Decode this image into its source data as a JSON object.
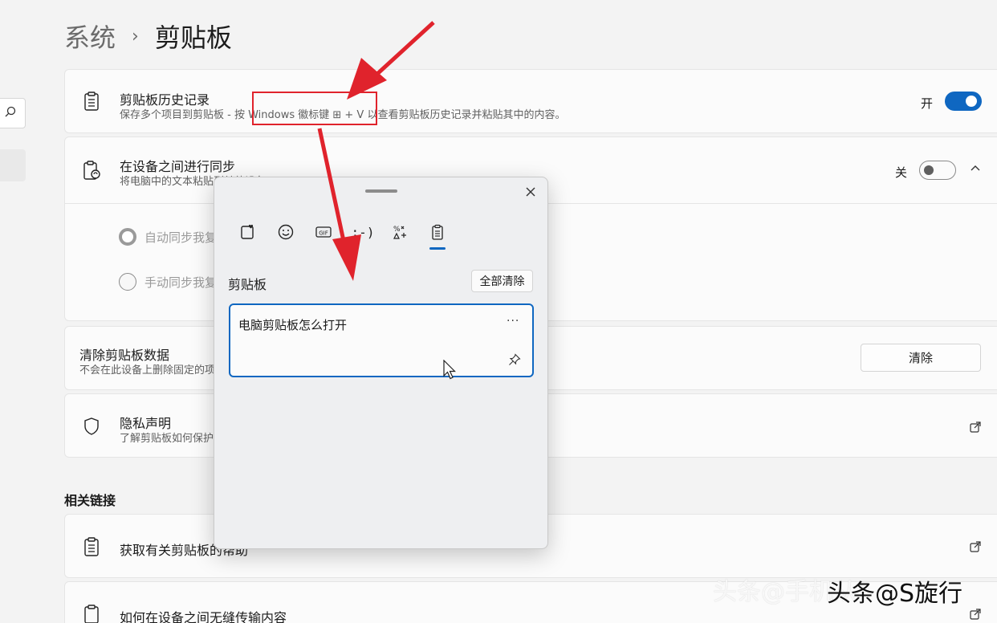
{
  "breadcrumb": {
    "parent": "系统",
    "separator": "›",
    "current": "剪贴板"
  },
  "history": {
    "title": "剪贴板历史记录",
    "desc": "保存多个项目到剪贴板 - 按 Windows 徽标键 ⊞ + V 以查看剪贴板历史记录并粘贴其中的内容。",
    "toggle_label": "开",
    "toggle_on": true
  },
  "sync": {
    "title": "在设备之间进行同步",
    "desc": "将电脑中的文本粘贴到其他设备",
    "toggle_label": "关",
    "toggle_on": false,
    "options": [
      "自动同步我复制的文本",
      "手动同步我复制的文本"
    ]
  },
  "clear_data": {
    "title": "清除剪贴板数据",
    "desc": "不会在此设备上删除固定的项目",
    "button": "清除"
  },
  "privacy": {
    "title": "隐私声明",
    "desc": "了解剪贴板如何保护你的数据"
  },
  "related": {
    "header": "相关链接",
    "links": [
      "获取有关剪贴板的帮助",
      "如何在设备之间无缝传输内容"
    ]
  },
  "popup": {
    "tabs": [
      "favorites-icon",
      "emoji-icon",
      "gif-icon",
      "kaomoji-icon",
      "symbols-icon",
      "clipboard-icon"
    ],
    "kaomoji_label": ";-)",
    "gif_label": "GIF",
    "title": "剪贴板",
    "clear_all": "全部清除",
    "items": [
      {
        "text": "电脑剪贴板怎么打开",
        "more": "···"
      }
    ]
  },
  "watermark": {
    "light": "头条@手机从",
    "dark": "头条@S旋行"
  },
  "colors": {
    "accent": "#0f67c1",
    "annotation": "#e0232c"
  }
}
